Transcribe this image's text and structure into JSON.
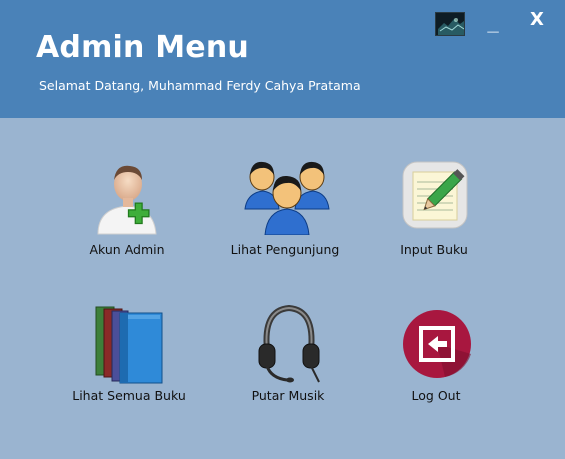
{
  "header": {
    "title": "Admin Menu",
    "subtitle": "Selamat Datang, Muhammad Ferdy Cahya Pratama"
  },
  "window_controls": {
    "minimize_label": "_",
    "close_label": "X"
  },
  "colors": {
    "header_bg": "#4a82b8",
    "body_bg": "#9ab4d0",
    "logout_circle": "#a8173f"
  },
  "menu": [
    {
      "label": "Akun Admin",
      "icon": "user-add-icon"
    },
    {
      "label": "Lihat Pengunjung",
      "icon": "people-group-icon"
    },
    {
      "label": "Input Buku",
      "icon": "notepad-pencil-icon"
    },
    {
      "label": "Lihat Semua Buku",
      "icon": "books-icon"
    },
    {
      "label": "Putar Musik",
      "icon": "headphones-icon"
    },
    {
      "label": "Log Out",
      "icon": "logout-icon"
    }
  ]
}
